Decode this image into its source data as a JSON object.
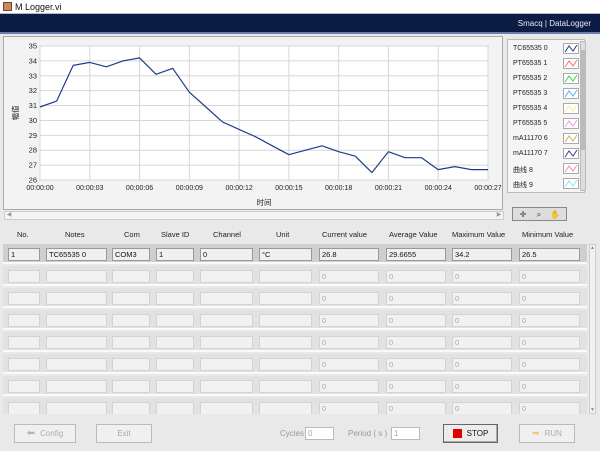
{
  "window": {
    "title": "M Logger.vi",
    "brand": "Smacq | DataLogger"
  },
  "chart_data": {
    "type": "line",
    "ylabel": "幅值",
    "xlabel": "时间",
    "ylim": [
      26,
      35
    ],
    "xlim": [
      0,
      27
    ],
    "yticks": [
      "26",
      "27",
      "28",
      "29",
      "30",
      "31",
      "32",
      "33",
      "34",
      "35"
    ],
    "xticks": [
      "00:00:00",
      "00:00:03",
      "00:00:06",
      "00:00:09",
      "00:00:12",
      "00:00:15",
      "00:00:18",
      "00:00:21",
      "00:00:24",
      "00:00:27"
    ],
    "grid": true,
    "series": [
      {
        "name": "TC65535 0",
        "color": "#1f3e8a",
        "x": [
          0,
          1,
          2,
          3,
          4,
          5,
          6,
          7,
          8,
          9,
          10,
          11,
          12,
          13,
          14,
          15,
          16,
          17,
          18,
          19,
          20,
          21,
          22,
          23,
          24,
          25,
          26,
          27
        ],
        "y": [
          30.9,
          31.3,
          33.7,
          33.9,
          33.6,
          34.0,
          34.2,
          33.1,
          33.5,
          31.9,
          30.9,
          29.9,
          29.4,
          28.9,
          28.3,
          27.7,
          28.0,
          28.3,
          27.9,
          27.6,
          26.5,
          27.9,
          27.5,
          27.5,
          26.7,
          26.9,
          26.7,
          26.7
        ]
      }
    ]
  },
  "legend": [
    {
      "label": "TC65535 0",
      "color": "#1f3e8a"
    },
    {
      "label": "PT65535 1",
      "color": "#ff6a6a"
    },
    {
      "label": "PT65535 2",
      "color": "#3fd23f"
    },
    {
      "label": "PT65535 3",
      "color": "#55aaff"
    },
    {
      "label": "PT65535 4",
      "color": "#f2f290"
    },
    {
      "label": "PT65535 5",
      "color": "#ee99ee"
    },
    {
      "label": "mA11170 6",
      "color": "#c8b060"
    },
    {
      "label": "mA11170 7",
      "color": "#3a3a90"
    },
    {
      "label": "曲线 8",
      "color": "#ff88aa"
    },
    {
      "label": "曲线 9",
      "color": "#88e8e8"
    }
  ],
  "table": {
    "headers": [
      "No.",
      "Notes",
      "Com",
      "Slave ID",
      "Channel",
      "Unit",
      "Current value",
      "Average Value",
      "Maximum Value",
      "Minimum Value"
    ],
    "row1": {
      "no": "1",
      "notes": "TC65535 0",
      "com": "COM3",
      "slave": "1",
      "channel": "0",
      "unit": "°C",
      "current": "26.8",
      "average": "29.6655",
      "maximum": "34.2",
      "minimum": "26.5"
    },
    "empty_value": "0"
  },
  "controls": {
    "config": "Config",
    "exit": "Exit",
    "cycles_label": "Cycles",
    "cycles_value": "0",
    "period_label": "Period ( s )",
    "period_value": "1",
    "stop": "STOP",
    "run": "RUN"
  }
}
